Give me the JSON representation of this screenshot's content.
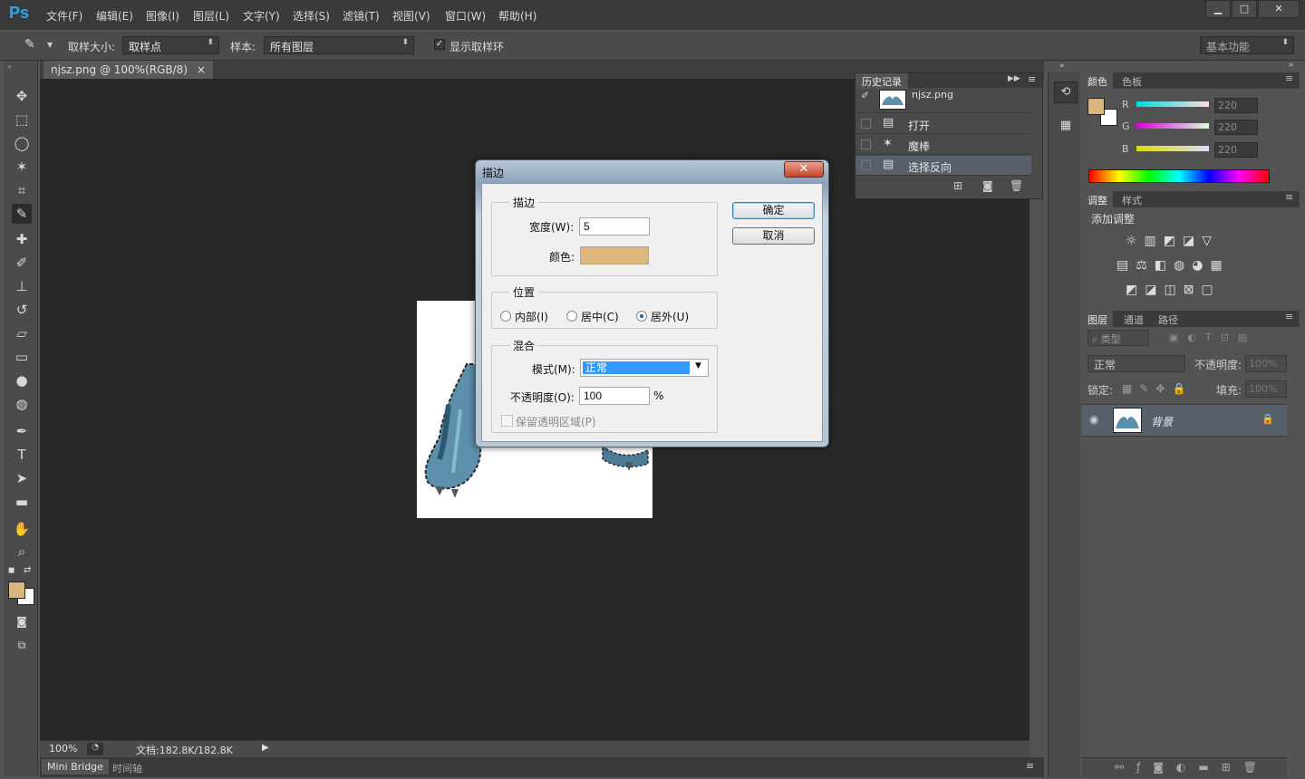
{
  "app": {
    "logo": "Ps"
  },
  "menu": [
    "文件(F)",
    "编辑(E)",
    "图像(I)",
    "图层(L)",
    "文字(Y)",
    "选择(S)",
    "滤镜(T)",
    "视图(V)",
    "窗口(W)",
    "帮助(H)"
  ],
  "window_buttons": {
    "minimize": "▁",
    "maximize": "□",
    "close": "✕"
  },
  "options": {
    "sample_size_label": "取样大小:",
    "sample_size_value": "取样点",
    "sample_label": "样本:",
    "sample_value": "所有图层",
    "show_ring_label": "显示取样环",
    "workspace": "基本功能"
  },
  "document": {
    "tab_title": "njsz.png @ 100%(RGB/8)",
    "tab_close": "×",
    "zoom": "100%",
    "doc_info": "文档:182.8K/182.8K",
    "bottom_tabs": [
      "Mini Bridge",
      "时间轴"
    ]
  },
  "history": {
    "tab": "历史记录",
    "snapshot": "njsz.png",
    "items": [
      {
        "label": "打开",
        "icon": "▤"
      },
      {
        "label": "魔棒",
        "icon": "✶"
      },
      {
        "label": "选择反向",
        "icon": "▤"
      }
    ]
  },
  "color_panel": {
    "tabs": [
      "颜色",
      "色板"
    ],
    "channels": [
      {
        "name": "R",
        "value": "220"
      },
      {
        "name": "G",
        "value": "220"
      },
      {
        "name": "B",
        "value": "220"
      }
    ],
    "fg_color": "#dbb57e"
  },
  "adjust_panel": {
    "tabs": [
      "调整",
      "样式"
    ],
    "title": "添加调整"
  },
  "layers_panel": {
    "tabs": [
      "图层",
      "通道",
      "路径"
    ],
    "filter": "类型",
    "blend_mode": "正常",
    "opacity_label": "不透明度:",
    "opacity_value": "100%",
    "lock_label": "锁定:",
    "fill_label": "填充:",
    "fill_value": "100%",
    "layer_name": "背景"
  },
  "dialog": {
    "title": "描边",
    "close": "✕",
    "stroke_group": "描边",
    "width_label": "宽度(W):",
    "width_value": "5",
    "color_label": "颜色:",
    "color_value": "#dfb77a",
    "position_group": "位置",
    "inside": "内部(I)",
    "center": "居中(C)",
    "outside": "居外(U)",
    "blend_group": "混合",
    "mode_label": "模式(M):",
    "mode_value": "正常",
    "opacity_label": "不透明度(O):",
    "opacity_value": "100",
    "percent": "%",
    "preserve_label": "保留透明区域(P)",
    "ok": "确定",
    "cancel": "取消"
  }
}
